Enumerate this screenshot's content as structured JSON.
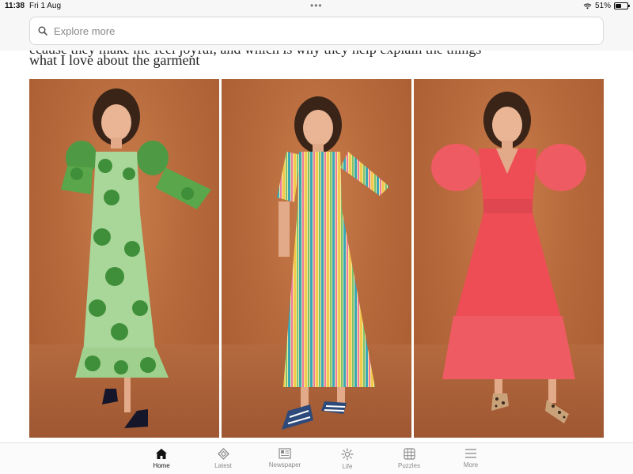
{
  "status_bar": {
    "time": "11:38",
    "date": "Fri 1 Aug",
    "battery_text": "51%",
    "battery_level": 0.51
  },
  "search": {
    "placeholder": "Explore more"
  },
  "article": {
    "partial_text": "ecause they make me feel joyful, and which is why they help explain the things",
    "heading_text": "what I love about the garment"
  },
  "gallery": [
    {
      "name": "green-floral-dress-photo",
      "dress_color": "#5aa64a"
    },
    {
      "name": "striped-dress-photo",
      "dress_color": "#f0d36a"
    },
    {
      "name": "coral-dress-photo",
      "dress_color": "#ee4d55"
    }
  ],
  "tabs": [
    {
      "label": "Home",
      "icon": "home-icon",
      "active": true
    },
    {
      "label": "Latest",
      "icon": "latest-icon",
      "active": false
    },
    {
      "label": "Newspaper",
      "icon": "newspaper-icon",
      "active": false
    },
    {
      "label": "Life",
      "icon": "life-icon",
      "active": false
    },
    {
      "label": "Puzzles",
      "icon": "puzzles-icon",
      "active": false
    },
    {
      "label": "More",
      "icon": "more-icon",
      "active": false
    }
  ]
}
